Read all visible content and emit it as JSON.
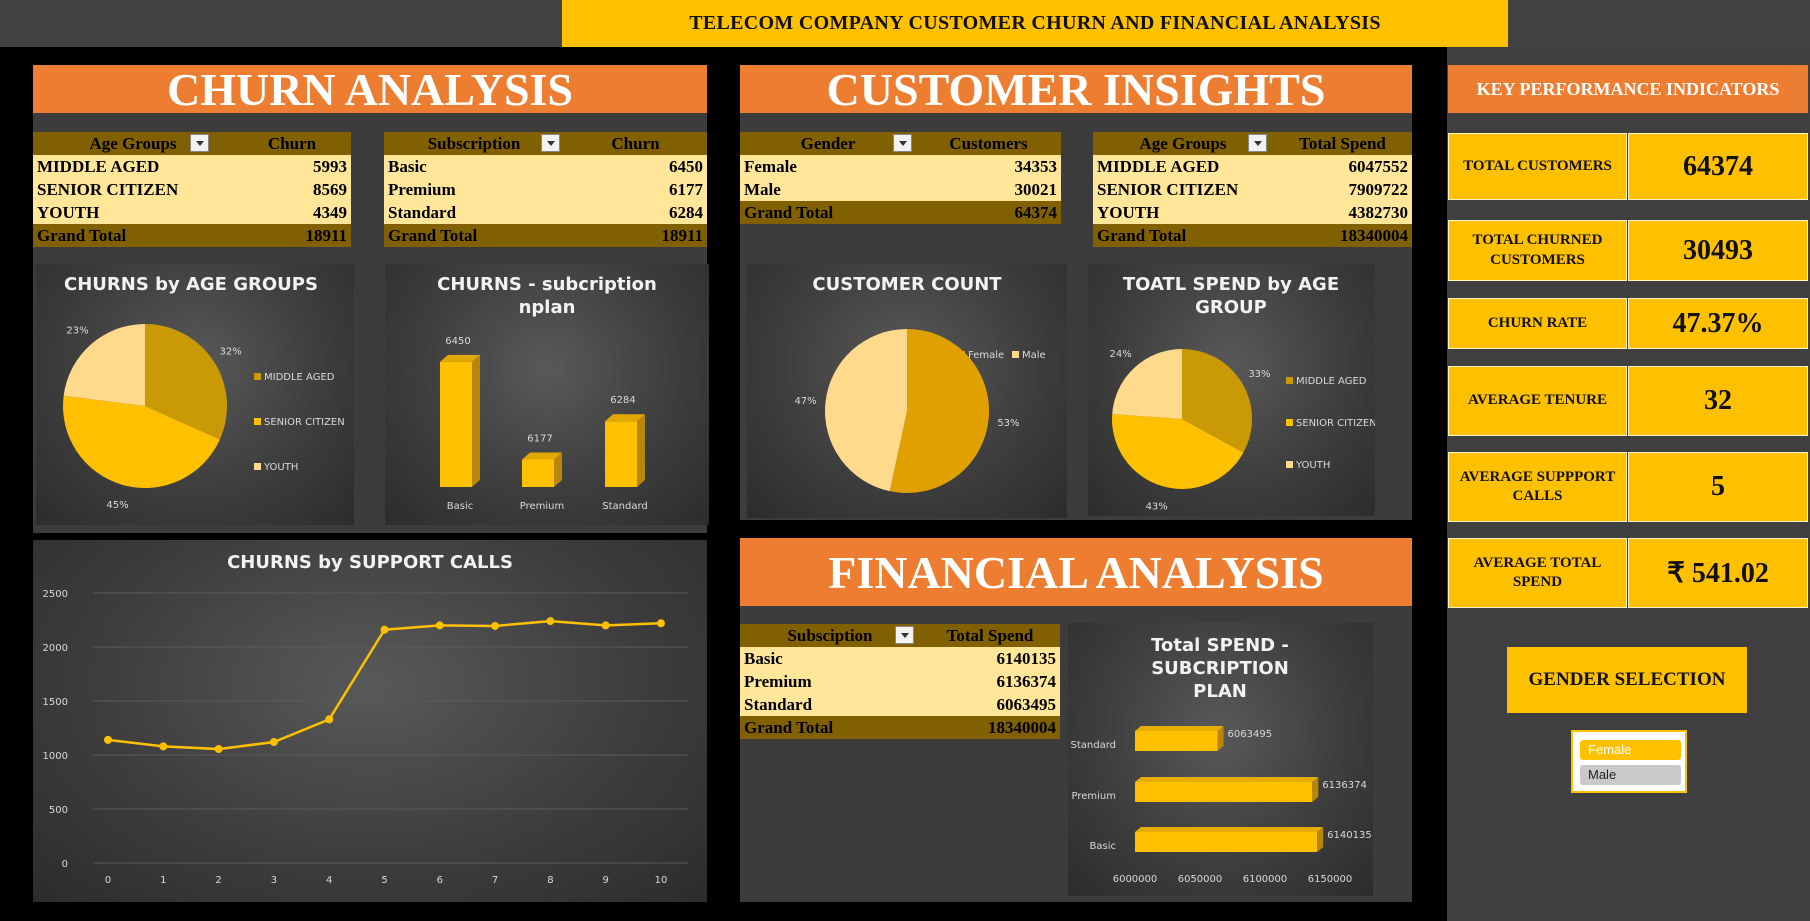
{
  "title": "TELECOM COMPANY CUSTOMER CHURN AND FINANCIAL ANALYSIS",
  "sections": {
    "churn": "CHURN ANALYSIS",
    "insights": "CUSTOMER INSIGHTS",
    "financial": "FINANCIAL ANALYSIS"
  },
  "tables": {
    "churn_age": {
      "headers": [
        "Age Groups",
        "Churn"
      ],
      "rows": [
        [
          "MIDDLE AGED",
          "5993"
        ],
        [
          "SENIOR CITIZEN",
          "8569"
        ],
        [
          "YOUTH",
          "4349"
        ]
      ],
      "total": [
        "Grand Total",
        "18911"
      ]
    },
    "churn_sub": {
      "headers": [
        "Subscription",
        "Churn"
      ],
      "rows": [
        [
          "Basic",
          "6450"
        ],
        [
          "Premium",
          "6177"
        ],
        [
          "Standard",
          "6284"
        ]
      ],
      "total": [
        "Grand Total",
        "18911"
      ]
    },
    "gender": {
      "headers": [
        "Gender",
        "Customers"
      ],
      "rows": [
        [
          "Female",
          "34353"
        ],
        [
          "Male",
          "30021"
        ]
      ],
      "total": [
        "Grand Total",
        "64374"
      ]
    },
    "spend_age": {
      "headers": [
        "Age Groups",
        "Total Spend"
      ],
      "rows": [
        [
          "MIDDLE AGED",
          "6047552"
        ],
        [
          "SENIOR CITIZEN",
          "7909722"
        ],
        [
          "YOUTH",
          "4382730"
        ]
      ],
      "total": [
        "Grand Total",
        "18340004"
      ]
    },
    "spend_sub": {
      "headers": [
        "Subsciption",
        "Total Spend"
      ],
      "rows": [
        [
          "Basic",
          "6140135"
        ],
        [
          "Premium",
          "6136374"
        ],
        [
          "Standard",
          "6063495"
        ]
      ],
      "total": [
        "Grand Total",
        "18340004"
      ]
    }
  },
  "chart_data": [
    {
      "id": "churn_age_pie",
      "type": "pie",
      "title": "CHURNS by AGE GROUPS",
      "categories": [
        "MIDDLE AGED",
        "SENIOR CITIZEN",
        "YOUTH"
      ],
      "values": [
        5993,
        8569,
        4349
      ],
      "labels": [
        "32%",
        "45%",
        "23%"
      ],
      "colors": [
        "#c99a06",
        "#ffc000",
        "#ffd98c"
      ],
      "legend": "right"
    },
    {
      "id": "churn_sub_bar",
      "type": "bar",
      "title": "CHURNS - subcription nplan",
      "categories": [
        "Basic",
        "Premium",
        "Standard"
      ],
      "values": [
        6450,
        6177,
        6284
      ],
      "ylim": [
        6100,
        6500
      ]
    },
    {
      "id": "customer_pie",
      "type": "pie",
      "title": "CUSTOMER COUNT",
      "categories": [
        "Female",
        "Male"
      ],
      "values": [
        34353,
        30021
      ],
      "labels": [
        "53%",
        "47%"
      ],
      "colors": [
        "#e0a000",
        "#ffd98c"
      ],
      "legend": "top-right"
    },
    {
      "id": "spend_age_pie",
      "type": "pie",
      "title": "TOATL SPEND by AGE GROUP",
      "categories": [
        "MIDDLE AGED",
        "SENIOR CITIZEN",
        "YOUTH"
      ],
      "values": [
        6047552,
        7909722,
        4382730
      ],
      "labels": [
        "33%",
        "43%",
        "24%"
      ],
      "colors": [
        "#c99a06",
        "#ffc000",
        "#ffd98c"
      ],
      "legend": "right"
    },
    {
      "id": "support_line",
      "type": "line",
      "title": "CHURNS by SUPPORT CALLS",
      "x": [
        0,
        1,
        2,
        3,
        4,
        5,
        6,
        7,
        8,
        9,
        10
      ],
      "values": [
        1140,
        1080,
        1055,
        1120,
        1330,
        2160,
        2200,
        2195,
        2240,
        2200,
        2220
      ],
      "ylim": [
        0,
        2500
      ],
      "yticks": [
        0,
        500,
        1000,
        1500,
        2000,
        2500
      ]
    },
    {
      "id": "spend_sub_bar",
      "type": "bar",
      "orientation": "horizontal",
      "title": "Total SPEND - SUBCRIPTION PLAN",
      "categories": [
        "Standard",
        "Premium",
        "Basic"
      ],
      "values": [
        6063495,
        6136374,
        6140135
      ],
      "xlim": [
        6000000,
        6150000
      ],
      "xticks": [
        6000000,
        6050000,
        6100000,
        6150000
      ]
    }
  ],
  "kpi": {
    "title": "KEY PERFORMANCE INDICATORS",
    "items": [
      {
        "label": "TOTAL CUSTOMERS",
        "value": "64374"
      },
      {
        "label": "TOTAL CHURNED CUSTOMERS",
        "value": "30493"
      },
      {
        "label": "CHURN RATE",
        "value": "47.37%"
      },
      {
        "label": "AVERAGE TENURE",
        "value": "32"
      },
      {
        "label": "AVERAGE SUPPPORT CALLS",
        "value": "5"
      },
      {
        "label": "AVERAGE TOTAL SPEND",
        "value": "₹ 541.02"
      }
    ]
  },
  "gender_selection": {
    "label": "GENDER SELECTION",
    "options": [
      "Female",
      "Male"
    ]
  }
}
